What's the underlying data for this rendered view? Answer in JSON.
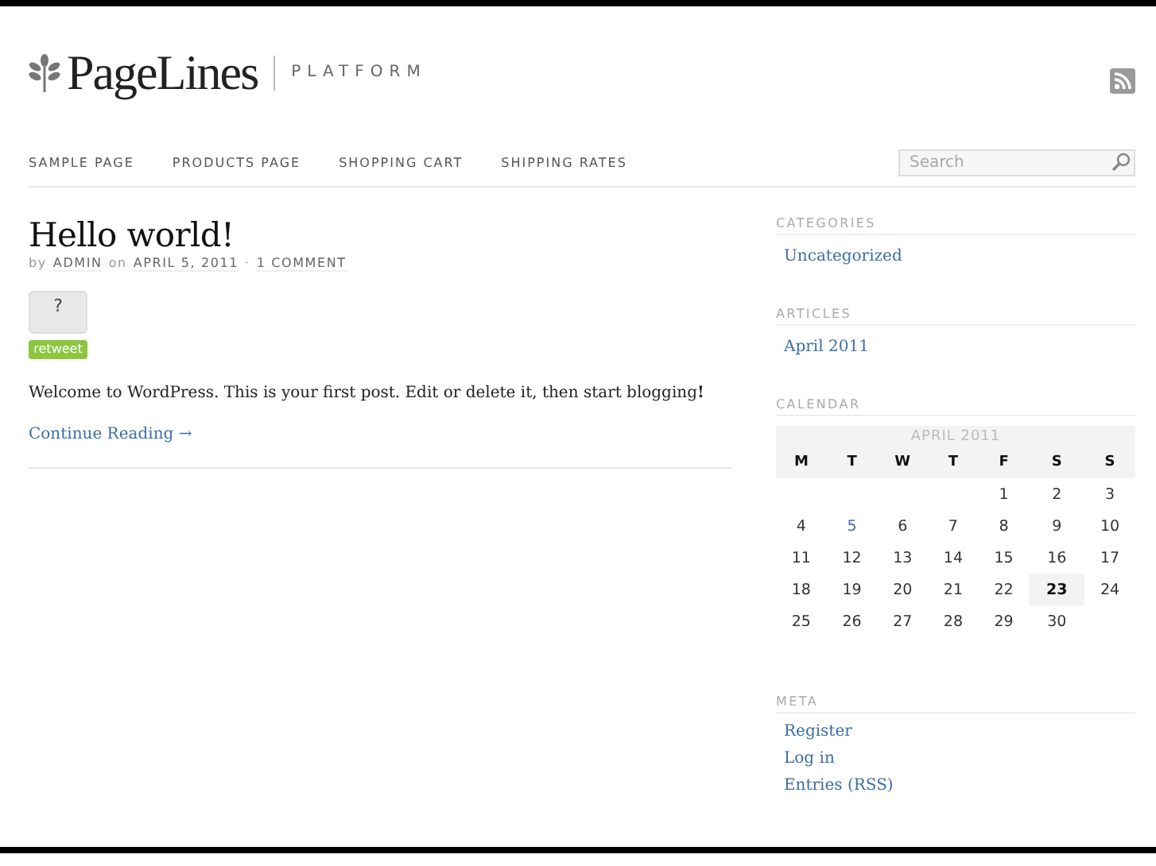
{
  "header": {
    "logo": "PageLines",
    "tagline": "PLATFORM"
  },
  "nav": [
    {
      "label": "SAMPLE PAGE"
    },
    {
      "label": "PRODUCTS PAGE"
    },
    {
      "label": "SHOPPING CART"
    },
    {
      "label": "SHIPPING RATES"
    }
  ],
  "search": {
    "placeholder": "Search"
  },
  "post": {
    "title": "Hello world!",
    "by": "by",
    "author": "ADMIN",
    "on": "on",
    "date": "APRIL 5, 2011",
    "separator": "·",
    "comments": "1 COMMENT",
    "tweet_count": "?",
    "retweet": "retweet",
    "body": "Welcome to WordPress. This is your first post. Edit or delete it, then start blogging**!**",
    "more": "Continue Reading →"
  },
  "sidebar": [
    {
      "kind": "links",
      "title": "CATEGORIES",
      "links": [
        "Uncategorized"
      ]
    },
    {
      "kind": "links",
      "title": "ARTICLES",
      "links": [
        "April 2011"
      ]
    },
    {
      "kind": "calendar",
      "title": "CALENDAR",
      "caption": "APRIL 2011",
      "weekdays": [
        "M",
        "T",
        "W",
        "T",
        "F",
        "S",
        "S"
      ],
      "weeks": [
        [
          {
            "text": "1",
            "kind": "plain"
          },
          {
            "text": "2",
            "kind": "plain"
          },
          {
            "text": "3",
            "kind": "plain"
          }
        ],
        [
          {
            "text": "4",
            "kind": "plain"
          },
          {
            "text": "5",
            "kind": "link"
          },
          {
            "text": "6",
            "kind": "plain"
          },
          {
            "text": "7",
            "kind": "plain"
          },
          {
            "text": "8",
            "kind": "plain"
          },
          {
            "text": "9",
            "kind": "plain"
          },
          {
            "text": "10",
            "kind": "plain"
          }
        ],
        [
          {
            "text": "11",
            "kind": "plain"
          },
          {
            "text": "12",
            "kind": "plain"
          },
          {
            "text": "13",
            "kind": "plain"
          },
          {
            "text": "14",
            "kind": "plain"
          },
          {
            "text": "15",
            "kind": "plain"
          },
          {
            "text": "16",
            "kind": "plain"
          },
          {
            "text": "17",
            "kind": "plain"
          }
        ],
        [
          {
            "text": "18",
            "kind": "plain"
          },
          {
            "text": "19",
            "kind": "plain"
          },
          {
            "text": "20",
            "kind": "plain"
          },
          {
            "text": "21",
            "kind": "plain"
          },
          {
            "text": "22",
            "kind": "plain"
          },
          {
            "text": "23",
            "kind": "today"
          },
          {
            "text": "24",
            "kind": "plain"
          }
        ],
        [
          {
            "text": "25",
            "kind": "plain"
          },
          {
            "text": "26",
            "kind": "plain"
          },
          {
            "text": "27",
            "kind": "plain"
          },
          {
            "text": "28",
            "kind": "plain"
          },
          {
            "text": "29",
            "kind": "plain"
          },
          {
            "text": "30",
            "kind": "plain"
          }
        ]
      ]
    },
    {
      "kind": "links",
      "title": "META",
      "links": [
        "Register",
        "Log in",
        "Entries (RSS)"
      ]
    }
  ]
}
